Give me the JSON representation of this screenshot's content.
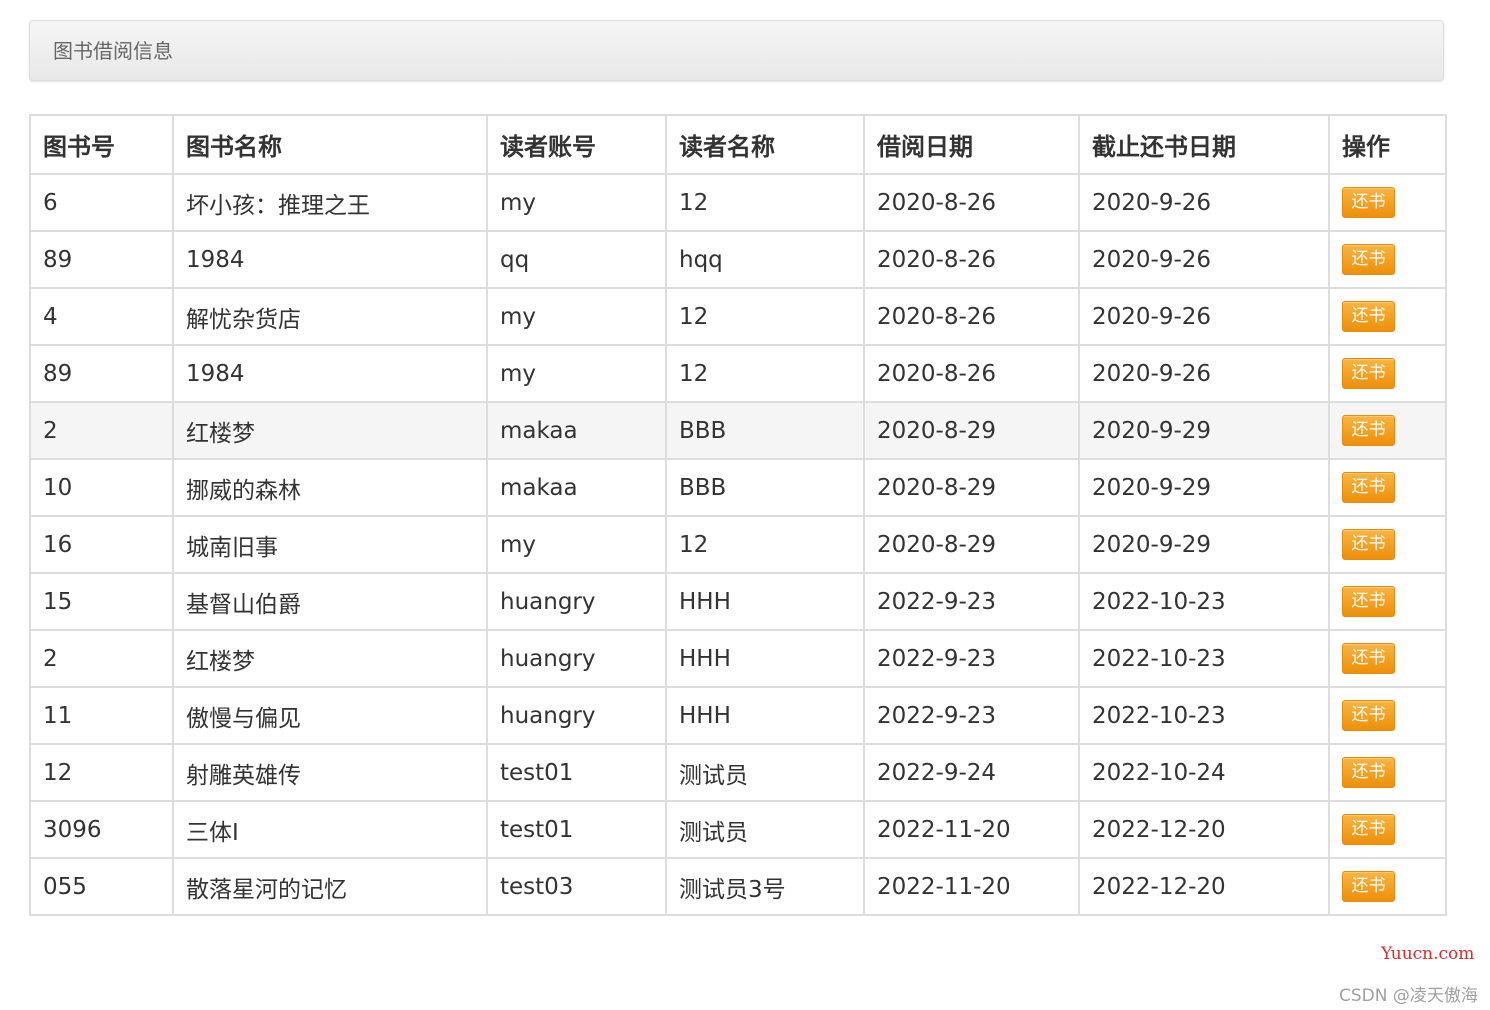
{
  "panel": {
    "title": "图书借阅信息"
  },
  "table": {
    "headers": [
      "图书号",
      "图书名称",
      "读者账号",
      "读者名称",
      "借阅日期",
      "截止还书日期",
      "操作"
    ],
    "button_label": "还书",
    "rows": [
      {
        "book_id": "6",
        "book_name": "坏小孩：推理之王",
        "reader_account": "my",
        "reader_name": "12",
        "borrow_date": "2020-8-26",
        "due_date": "2020-9-26"
      },
      {
        "book_id": "89",
        "book_name": "1984",
        "reader_account": "qq",
        "reader_name": "hqq",
        "borrow_date": "2020-8-26",
        "due_date": "2020-9-26"
      },
      {
        "book_id": "4",
        "book_name": "解忧杂货店",
        "reader_account": "my",
        "reader_name": "12",
        "borrow_date": "2020-8-26",
        "due_date": "2020-9-26"
      },
      {
        "book_id": "89",
        "book_name": "1984",
        "reader_account": "my",
        "reader_name": "12",
        "borrow_date": "2020-8-26",
        "due_date": "2020-9-26"
      },
      {
        "book_id": "2",
        "book_name": "红楼梦",
        "reader_account": "makaa",
        "reader_name": "BBB",
        "borrow_date": "2020-8-29",
        "due_date": "2020-9-29"
      },
      {
        "book_id": "10",
        "book_name": "挪威的森林",
        "reader_account": "makaa",
        "reader_name": "BBB",
        "borrow_date": "2020-8-29",
        "due_date": "2020-9-29"
      },
      {
        "book_id": "16",
        "book_name": "城南旧事",
        "reader_account": "my",
        "reader_name": "12",
        "borrow_date": "2020-8-29",
        "due_date": "2020-9-29"
      },
      {
        "book_id": "15",
        "book_name": "基督山伯爵",
        "reader_account": "huangry",
        "reader_name": "HHH",
        "borrow_date": "2022-9-23",
        "due_date": "2022-10-23"
      },
      {
        "book_id": "2",
        "book_name": "红楼梦",
        "reader_account": "huangry",
        "reader_name": "HHH",
        "borrow_date": "2022-9-23",
        "due_date": "2022-10-23"
      },
      {
        "book_id": "11",
        "book_name": "傲慢与偏见",
        "reader_account": "huangry",
        "reader_name": "HHH",
        "borrow_date": "2022-9-23",
        "due_date": "2022-10-23"
      },
      {
        "book_id": "12",
        "book_name": "射雕英雄传",
        "reader_account": "test01",
        "reader_name": "测试员",
        "borrow_date": "2022-9-24",
        "due_date": "2022-10-24"
      },
      {
        "book_id": "3096",
        "book_name": "三体I",
        "reader_account": "test01",
        "reader_name": "测试员",
        "borrow_date": "2022-11-20",
        "due_date": "2022-12-20"
      },
      {
        "book_id": "055",
        "book_name": "散落星河的记忆",
        "reader_account": "test03",
        "reader_name": "测试员3号",
        "borrow_date": "2022-11-20",
        "due_date": "2022-12-20"
      }
    ]
  },
  "watermarks": {
    "site": "Yuucn.com",
    "author": "CSDN @凌天傲海"
  },
  "colors": {
    "button": "#f0ad4e",
    "border": "#dddddd",
    "hover_row": "#f5f5f5"
  }
}
